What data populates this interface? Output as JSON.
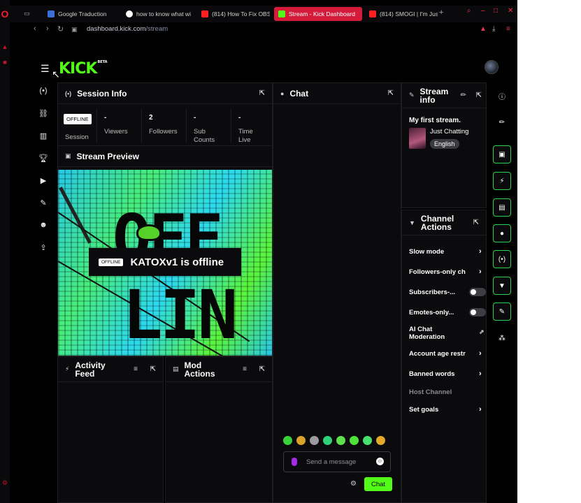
{
  "browser": {
    "tabs": [
      {
        "label": "Google Traduction",
        "color": "#3b6fd9"
      },
      {
        "label": "how to know what wi",
        "color": "#ffffff"
      },
      {
        "label": "(814) How To Fix OBS",
        "color": "#ff2020"
      },
      {
        "label": "Stream - Kick Dashboard",
        "color": "#53fc18"
      },
      {
        "label": "(814) SMOGI | I'm Jus",
        "color": "#ff2020"
      }
    ],
    "url_host": "dashboard.kick.com",
    "url_path": "/stream",
    "new_tab": "+"
  },
  "app": {
    "logo": "KICK",
    "logo_badge": "BETA",
    "accent": "#53fc18"
  },
  "session_info": {
    "title": "Session Info",
    "status_tag": "OFFLINE",
    "stats": [
      {
        "value": "",
        "label": "Session"
      },
      {
        "value": "-",
        "label": "Viewers"
      },
      {
        "value": "2",
        "label": "Followers"
      },
      {
        "value": "-",
        "label": "Sub Counts"
      },
      {
        "value": "-",
        "label": "Time Live"
      }
    ]
  },
  "stream_preview": {
    "title": "Stream Preview",
    "offline_tag": "OFFLINE",
    "offline_text": "KATOXv1 is offline",
    "bg_word_top": "OFF",
    "bg_word_bottom": "LIN"
  },
  "activity_feed": {
    "title": "Activity Feed"
  },
  "mod_actions": {
    "title": "Mod Actions"
  },
  "chat": {
    "title": "Chat",
    "placeholder": "Send a message",
    "send_label": "Chat",
    "emote_colors": [
      "#39d13a",
      "#d9a32a",
      "#9a9aa0",
      "#2fd07a",
      "#5de04c",
      "#4fe33a",
      "#49e070",
      "#e4a82b"
    ]
  },
  "stream_info": {
    "title": "Stream info",
    "stream_title": "My first stream.",
    "category": "Just Chatting",
    "language": "English"
  },
  "channel_actions": {
    "title": "Channel Actions",
    "items": [
      {
        "label": "Slow mode",
        "control": "chevron"
      },
      {
        "label": "Followers-only ch",
        "control": "chevron"
      },
      {
        "label": "Subscribers-...",
        "control": "toggle",
        "on": false
      },
      {
        "label": "Emotes-only...",
        "control": "toggle",
        "on": false
      },
      {
        "label": "AI Chat Moderation",
        "control": "external"
      },
      {
        "label": "Account age restr",
        "control": "chevron"
      },
      {
        "label": "Banned words",
        "control": "chevron"
      },
      {
        "label": "Host Channel",
        "control": "none"
      },
      {
        "label": "Set goals",
        "control": "chevron"
      }
    ]
  }
}
